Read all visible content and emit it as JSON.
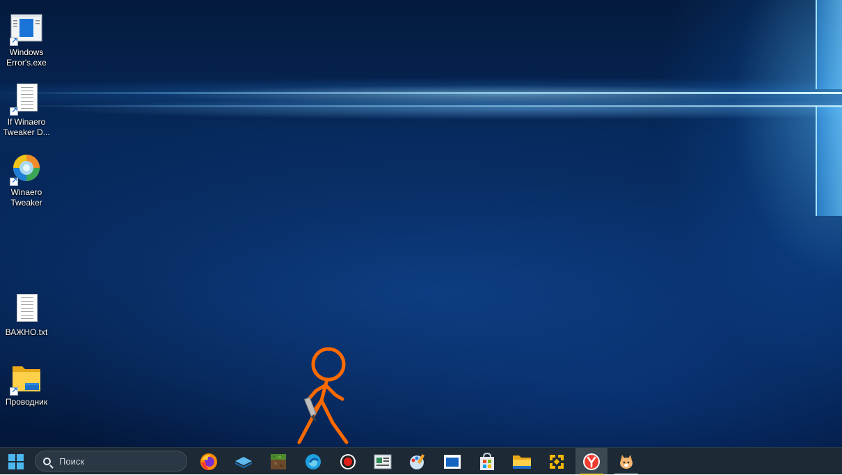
{
  "desktop": {
    "icons": [
      {
        "label": "Windows Error's.exe",
        "icon": "windows-errors-app-icon"
      },
      {
        "label": "If Winaero Tweaker D...",
        "icon": "text-document-icon"
      },
      {
        "label": "Winaero Tweaker",
        "icon": "winaero-tweaker-icon"
      },
      {
        "label": "ВАЖНО.txt",
        "icon": "text-document-icon"
      },
      {
        "label": "Проводник",
        "icon": "folder-icon"
      }
    ],
    "stick_figure_color": "#ff6a00"
  },
  "taskbar": {
    "start_icon": "windows-start-icon",
    "search_placeholder": "Поиск",
    "apps": [
      {
        "icon": "firefox-icon"
      },
      {
        "icon": "layers-app-icon"
      },
      {
        "icon": "minecraft-icon"
      },
      {
        "icon": "edge-icon"
      },
      {
        "icon": "record-icon"
      },
      {
        "icon": "news-app-icon"
      },
      {
        "icon": "paint-icon"
      },
      {
        "icon": "media-window-icon"
      },
      {
        "icon": "store-icon"
      },
      {
        "icon": "file-explorer-icon"
      },
      {
        "icon": "vmware-icon"
      },
      {
        "icon": "yandex-browser-icon",
        "active": true
      },
      {
        "icon": "cat-app-icon"
      }
    ],
    "accent_color": "#f5d94a"
  }
}
